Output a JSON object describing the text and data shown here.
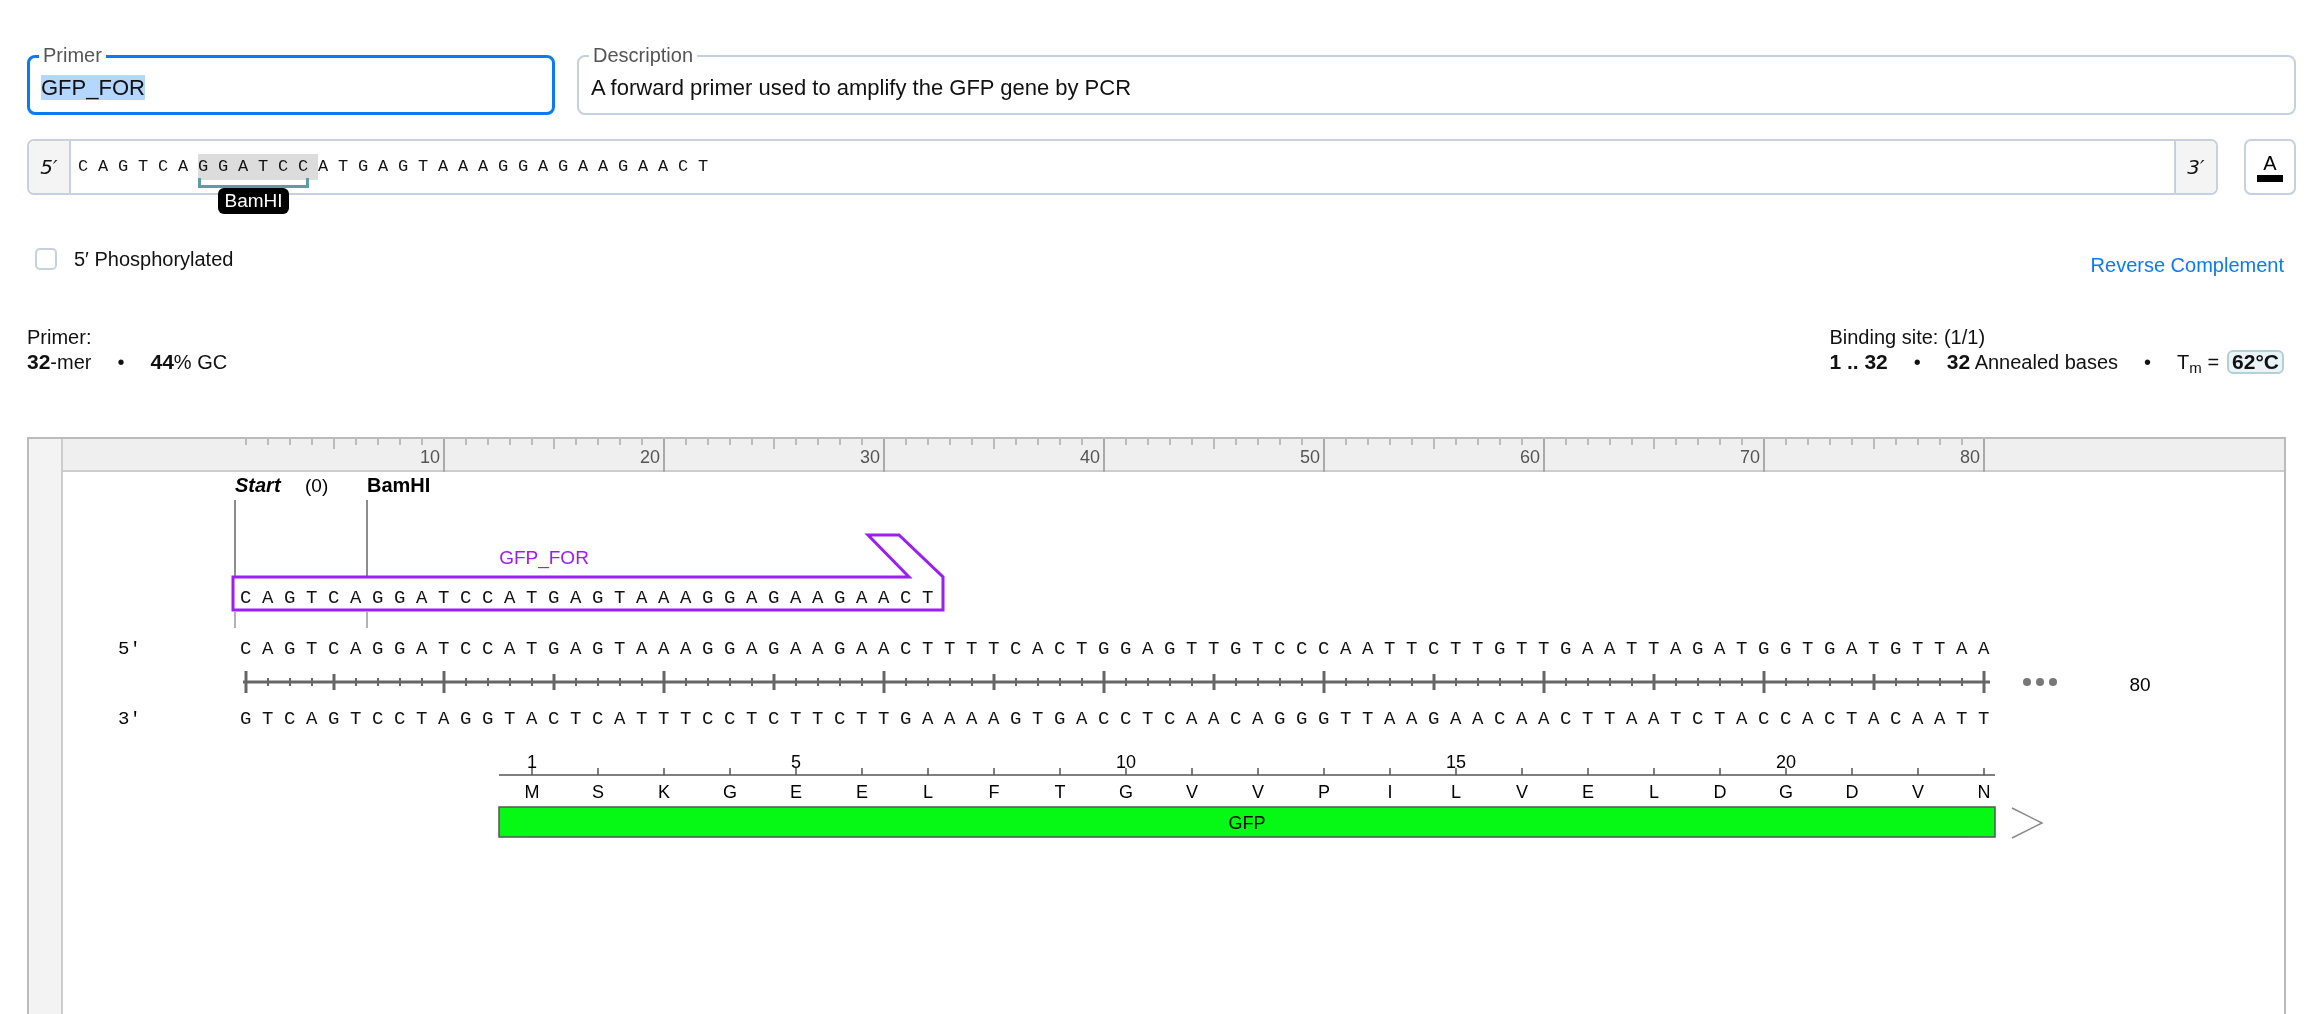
{
  "primer_field": {
    "label": "Primer",
    "value": "GFP_FOR",
    "focused": true
  },
  "description_field": {
    "label": "Description",
    "value": "A forward primer used to amplify the GFP gene by PCR",
    "focused": false
  },
  "sequence_input": {
    "five_prime": "5′",
    "three_prime": "3′",
    "parts": [
      {
        "text": "CAGTCA",
        "highlighted": false
      },
      {
        "text": "GGATCC",
        "highlighted": true,
        "site_label": "BamHI"
      },
      {
        "text": "ATGAGTAAAGGAGAAGAACT",
        "highlighted": false
      }
    ]
  },
  "format_button": {
    "label": "A"
  },
  "phosphorylated": {
    "label": "5′ Phosphorylated",
    "checked": false
  },
  "reverse_complement": {
    "label": "Reverse Complement"
  },
  "primer_stats": {
    "title": "Primer:",
    "items": [
      {
        "kind": "stat",
        "text": "**32**-mer"
      },
      {
        "kind": "separator",
        "text": "•"
      },
      {
        "kind": "stat",
        "text": "**44**% GC"
      }
    ]
  },
  "binding_stats": {
    "title": "Binding site: (1/1)",
    "items": [
      {
        "kind": "stat",
        "text": "**1 .. 32**"
      },
      {
        "kind": "separator",
        "text": "•"
      },
      {
        "kind": "stat",
        "text": "**32** Annealed bases"
      },
      {
        "kind": "separator",
        "text": "•"
      },
      {
        "kind": "stat",
        "text": "T$_{m}$ ="
      },
      {
        "kind": "badge",
        "text": "**62°C**"
      }
    ]
  },
  "map": {
    "ruler_labels": [
      "10",
      "20",
      "30",
      "40",
      "50",
      "60",
      "70",
      "80"
    ],
    "markers": [
      {
        "kind": "origin",
        "name": "Start",
        "position": "(0)"
      },
      {
        "kind": "site",
        "name": "BamHI"
      }
    ],
    "primer": {
      "name": "GFP_FOR",
      "sequence": "CAGTCAGGATCCATGAGTAAAGGAGAAGAACT"
    },
    "top_strand": {
      "label": "5′",
      "sequence": "CAGTCAGGATCCATGAGTAAAGGAGAAGAACTTTTCACTGGAGTTGTCCCAATTCTTGTTGAATTAGATGGTGATGTTAA"
    },
    "bottom_strand": {
      "label": "3′",
      "sequence": "GTCAGTCCTAGGTACTCATTTCCTCTTCTTGAAAAGTGACCTCAACAGGGTTAAGAACAACTTAATCTACCACTACAATT"
    },
    "length_label": "80",
    "feature": {
      "name": "GFP",
      "residue_numbers": [
        "1",
        "5",
        "10",
        "15",
        "20"
      ],
      "residues": [
        "M",
        "S",
        "K",
        "G",
        "E",
        "E",
        "L",
        "F",
        "T",
        "G",
        "V",
        "V",
        "P",
        "I",
        "L",
        "V",
        "E",
        "L",
        "D",
        "G",
        "D",
        "V",
        "N"
      ]
    }
  }
}
